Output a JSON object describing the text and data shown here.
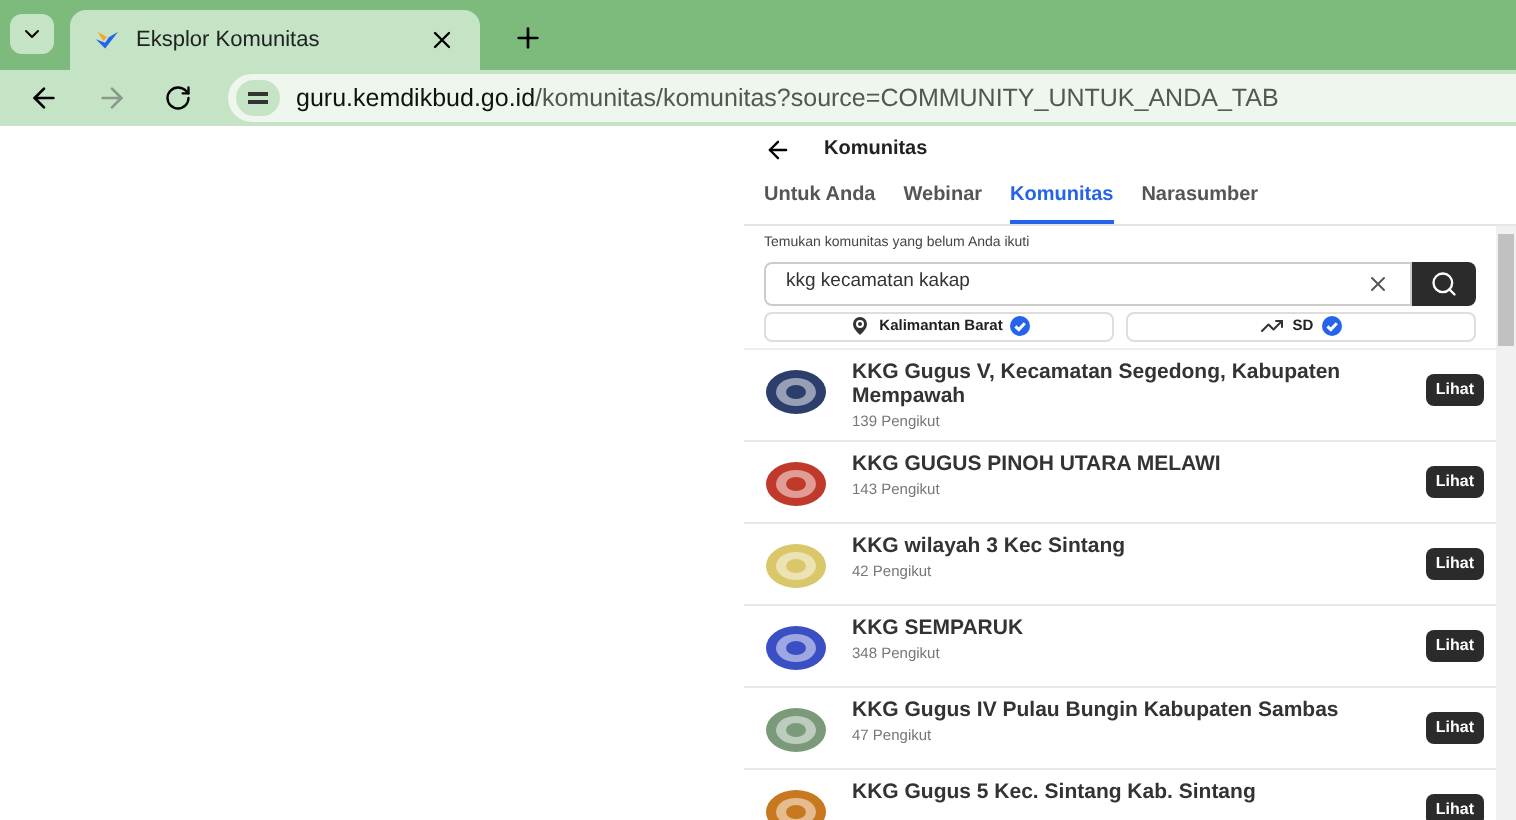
{
  "browser": {
    "tab_title": "Eksplor Komunitas",
    "url_host": "guru.kemdikbud.go.id",
    "url_path": "/komunitas/komunitas?source=COMMUNITY_UNTUK_ANDA_TAB"
  },
  "header": {
    "title": "Komunitas"
  },
  "tabs": [
    {
      "label": "Untuk Anda",
      "selected": false
    },
    {
      "label": "Webinar",
      "selected": false
    },
    {
      "label": "Komunitas",
      "selected": true
    },
    {
      "label": "Narasumber",
      "selected": false
    }
  ],
  "search": {
    "label": "Temukan komunitas yang belum Anda ikuti",
    "value": "kkg kecamatan kakap"
  },
  "filters": [
    {
      "kind": "location",
      "label": "Kalimantan Barat"
    },
    {
      "kind": "level",
      "label": "SD"
    }
  ],
  "communities": [
    {
      "name": "KKG Gugus V, Kecamatan Segedong, Kabupaten Mempawah",
      "followers": "139 Pengikut",
      "action": "Lihat",
      "color": "#2c3e6b"
    },
    {
      "name": "KKG GUGUS PINOH UTARA MELAWI",
      "followers": "143 Pengikut",
      "action": "Lihat",
      "color": "#c0392b"
    },
    {
      "name": "KKG wilayah 3 Kec Sintang",
      "followers": "42 Pengikut",
      "action": "Lihat",
      "color": "#d9c76a"
    },
    {
      "name": "KKG SEMPARUK",
      "followers": "348 Pengikut",
      "action": "Lihat",
      "color": "#3b4fc4"
    },
    {
      "name": "KKG Gugus IV Pulau Bungin Kabupaten Sambas",
      "followers": "47 Pengikut",
      "action": "Lihat",
      "color": "#7a9a7a"
    },
    {
      "name": "KKG Gugus 5 Kec. Sintang Kab. Sintang",
      "action": "Lihat",
      "color": "#c8781e"
    }
  ]
}
